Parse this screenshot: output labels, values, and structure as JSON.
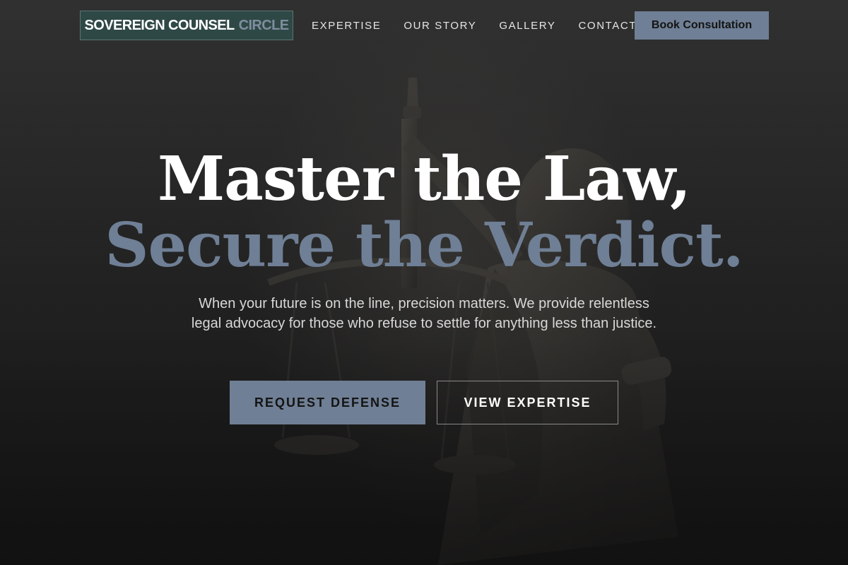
{
  "header": {
    "brand_primary": "SOVEREIGN COUNSEL",
    "brand_accent": "CIRCLE",
    "nav_links": [
      "EXPERTISE",
      "OUR STORY",
      "GALLERY",
      "CONTACT"
    ],
    "cta_label": "Book Consultation"
  },
  "hero": {
    "headline_line1": "Master the Law,",
    "headline_line2": "Secure the Verdict.",
    "subtext": "When your future is on the line, precision matters. We provide relentless legal advocacy for those who refuse to settle for anything less than justice.",
    "primary_button": "REQUEST DEFENSE",
    "secondary_button": "VIEW EXPERTISE",
    "background_image": "lady-justice-statue"
  },
  "colors": {
    "accent": "#6f7f95",
    "brand_box": "#2e4c4a",
    "background": "#1d1d1d",
    "text": "#ffffff"
  }
}
